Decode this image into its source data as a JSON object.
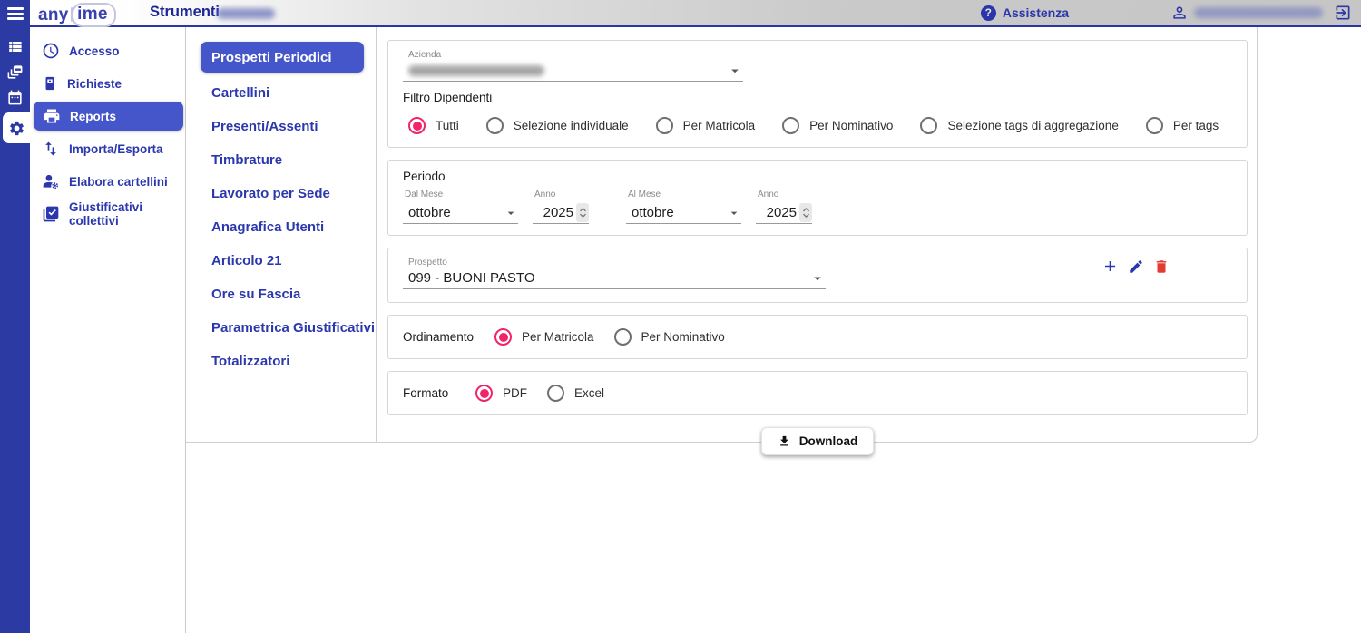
{
  "brand": {
    "name_prefix": "any",
    "name_suffix": "ime"
  },
  "header": {
    "title": "Strumenti",
    "title_suffix_redacted": true,
    "help_icon_glyph": "?",
    "help_label": "Assistenza",
    "user_email_redacted": true
  },
  "main_nav": {
    "active": "Reports",
    "items": [
      {
        "label": "Accesso",
        "icon": "clock-icon"
      },
      {
        "label": "Richieste",
        "icon": "device-icon"
      },
      {
        "label": "Reports",
        "icon": "printer-icon"
      },
      {
        "label": "Importa/Esporta",
        "icon": "import-export-icon"
      },
      {
        "label": "Elabora cartellini",
        "icon": "person-gear-icon"
      },
      {
        "label": "Giustificativi collettivi",
        "icon": "layered-check-icon"
      }
    ]
  },
  "reports_menu": {
    "active": "Prospetti Periodici",
    "items": [
      "Prospetti Periodici",
      "Cartellini",
      "Presenti/Assenti",
      "Timbrature",
      "Lavorato per Sede",
      "Anagrafica Utenti",
      "Articolo 21",
      "Ore su Fascia",
      "Parametrica Giustificativi",
      "Totalizzatori"
    ]
  },
  "form": {
    "azienda": {
      "label": "Azienda",
      "value_redacted": true
    },
    "filtro": {
      "label": "Filtro Dipendenti",
      "selected": "Tutti",
      "options": [
        "Tutti",
        "Selezione individuale",
        "Per Matricola",
        "Per Nominativo",
        "Selezione tags di aggregazione",
        "Per tags"
      ]
    },
    "periodo": {
      "title": "Periodo",
      "from_month": {
        "label": "Dal Mese",
        "value": "ottobre"
      },
      "from_year": {
        "label": "Anno",
        "value": "2025"
      },
      "to_month": {
        "label": "Al Mese",
        "value": "ottobre"
      },
      "to_year": {
        "label": "Anno",
        "value": "2025"
      }
    },
    "prospetto": {
      "label": "Prospetto",
      "value": "099 - BUONI PASTO"
    },
    "ordinamento": {
      "label": "Ordinamento",
      "selected": "Per Matricola",
      "options": [
        "Per Matricola",
        "Per Nominativo"
      ]
    },
    "formato": {
      "label": "Formato",
      "selected": "PDF",
      "options": [
        "PDF",
        "Excel"
      ]
    },
    "download": {
      "label": "Download"
    }
  },
  "colors": {
    "primary_blue": "#2c3aa3",
    "active_pill_blue": "#4456c9",
    "link_blue": "#2b38ad",
    "radio_pink": "#f0246b",
    "delete_red": "#e23b32"
  }
}
